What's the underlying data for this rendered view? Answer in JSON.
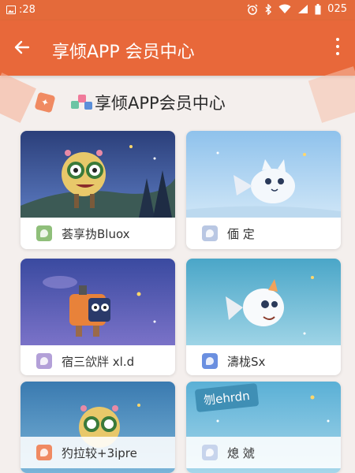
{
  "status_bar": {
    "time": ":28",
    "clock": "025",
    "icons": [
      "image-icon",
      "alarm-icon",
      "bluetooth-icon",
      "wifi-icon",
      "signal-icon",
      "battery-icon"
    ]
  },
  "app_bar": {
    "title": "享倾APP 会员中心",
    "back_icon": "back-arrow-icon",
    "menu_icon": "more-vert-icon"
  },
  "section": {
    "title": "享倾APP会员中心"
  },
  "cards": [
    {
      "label": "荟享㧑Bluox",
      "icon_color": "#8fbf7a"
    },
    {
      "label": "偭 定",
      "icon_color": "#b9c7e3"
    },
    {
      "label": "宿三欱牉 xl.d",
      "icon_color": "#b3a0d8"
    },
    {
      "label": "濤栊Sx",
      "icon_color": "#6a8fe0"
    },
    {
      "label": "犳拉较+3ipre",
      "icon_color": "#f08a62"
    },
    {
      "label": "熄 虠",
      "icon_color": "#c7d4ec"
    }
  ],
  "sticker_text": "刎ehrdn",
  "colors": {
    "primary": "#e8683a",
    "status_bar": "#e46a3a",
    "background": "#f4efed"
  }
}
